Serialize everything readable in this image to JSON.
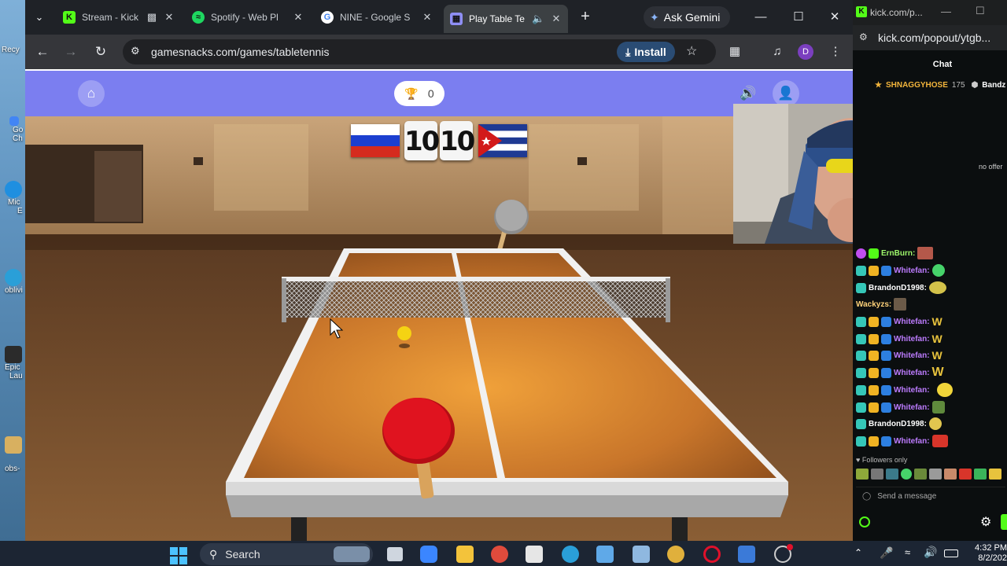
{
  "desktop": {
    "icons": [
      {
        "label": "Recy",
        "color": "#8aa6c2"
      },
      {
        "label": "Go",
        "sublabel": "Ch",
        "color": "#4285f4"
      },
      {
        "label": "Mic",
        "sublabel": "E",
        "color": "#1f8fe0"
      },
      {
        "label": "oblivi",
        "color": "#2a9fd8"
      },
      {
        "label": "Epic",
        "sublabel": "Lau",
        "color": "#2b2b2b"
      },
      {
        "label": "obs-",
        "color": "#d8b060"
      }
    ]
  },
  "browser": {
    "tabs": [
      {
        "title": "Stream - Kick",
        "favicon": "kick-icon",
        "color": "#53fc18"
      },
      {
        "title": "Spotify - Web Pl",
        "favicon": "spotify-icon",
        "color": "#1ed760"
      },
      {
        "title": "NINE - Google S",
        "favicon": "google-icon",
        "color": "#ffffff"
      },
      {
        "title": "Play Table Te",
        "favicon": "gamesnacks-icon",
        "color": "#8f8ff5",
        "active": true
      }
    ],
    "ask_gemini": "Ask Gemini",
    "url": "gamesnacks.com/games/tabletennis",
    "install_label": "Install",
    "profile_initial": "D"
  },
  "game": {
    "trophy_count": "0",
    "score_left": "10",
    "score_right": "10",
    "flag_left": "russia",
    "flag_right": "cuba",
    "colors": {
      "header": "#7b7ef0",
      "paddle": "#d8101c",
      "ball": "#f5d313"
    }
  },
  "chat": {
    "window_url": "kick.com/p...",
    "popout_url": "kick.com/popout/ytgb...",
    "title": "Chat",
    "pinned": [
      {
        "user": "SHNAGGYHOSE",
        "count": "175"
      },
      {
        "user": "Bandz"
      }
    ],
    "messages": [
      {
        "user": "ErnBurn:",
        "color": "#9ef76b",
        "emote": "face"
      },
      {
        "user": "Whitefan:",
        "color": "#bd7cff",
        "emote": "green"
      },
      {
        "user": "BrandonD1998:",
        "color": "#ffffff",
        "emote": "clap"
      },
      {
        "user": "Wackyzs:",
        "color": "#ffd27a",
        "emote": "person"
      },
      {
        "user": "Whitefan:",
        "color": "#bd7cff",
        "text": "W"
      },
      {
        "user": "Whitefan:",
        "color": "#bd7cff",
        "text": "W"
      },
      {
        "user": "Whitefan:",
        "color": "#bd7cff",
        "text": "W"
      },
      {
        "user": "Whitefan:",
        "color": "#bd7cff",
        "text": "W"
      },
      {
        "user": "Whitefan:",
        "color": "#bd7cff",
        "emote": "yellow"
      },
      {
        "user": "Whitefan:",
        "color": "#bd7cff",
        "emote": "frog"
      },
      {
        "user": "BrandonD1998:",
        "color": "#ffffff",
        "emote": "cool"
      },
      {
        "user": "Whitefan:",
        "color": "#bd7cff",
        "emote": "red"
      }
    ],
    "followers_only": "Followers only",
    "send_placeholder": "Send a message",
    "partial_offer": "no offer"
  },
  "taskbar": {
    "search_label": "Search",
    "time": "4:32 PM",
    "date": "8/2/202"
  }
}
